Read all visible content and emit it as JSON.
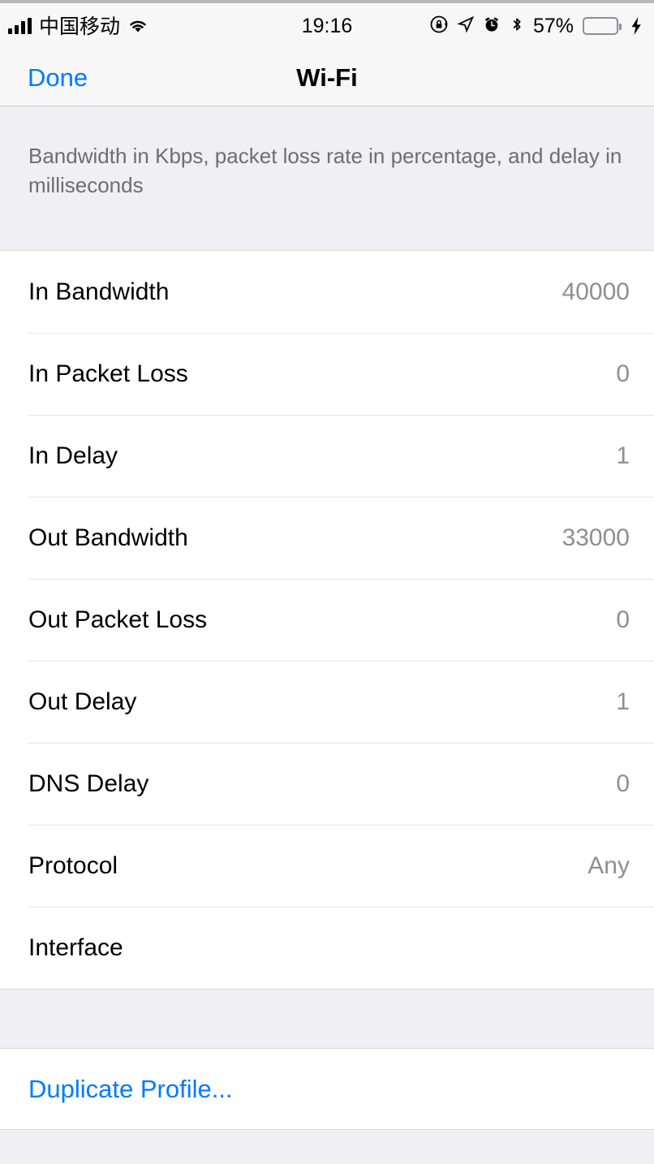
{
  "status_bar": {
    "carrier": "中国移动",
    "time": "19:16",
    "battery_percent": "57%",
    "battery_level": 57,
    "icons": {
      "signal": "signal-bars-icon",
      "wifi": "wifi-icon",
      "rotation_lock": "rotation-lock-icon",
      "location": "location-arrow-icon",
      "alarm": "alarm-clock-icon",
      "bluetooth": "bluetooth-icon",
      "battery": "battery-icon",
      "charging": "charging-bolt-icon"
    }
  },
  "nav_bar": {
    "done_label": "Done",
    "title": "Wi-Fi"
  },
  "section_header": {
    "description": "Bandwidth in Kbps, packet loss rate in percentage, and delay in milliseconds"
  },
  "settings_rows": [
    {
      "label": "In Bandwidth",
      "value": "40000"
    },
    {
      "label": "In Packet Loss",
      "value": "0"
    },
    {
      "label": "In Delay",
      "value": "1"
    },
    {
      "label": "Out Bandwidth",
      "value": "33000"
    },
    {
      "label": "Out Packet Loss",
      "value": "0"
    },
    {
      "label": "Out Delay",
      "value": "1"
    },
    {
      "label": "DNS Delay",
      "value": "0"
    },
    {
      "label": "Protocol",
      "value": "Any"
    },
    {
      "label": "Interface",
      "value": ""
    }
  ],
  "actions": [
    {
      "label": "Duplicate Profile..."
    }
  ],
  "colors": {
    "accent_blue": "#007aff",
    "value_gray": "#8e8e93",
    "group_background": "#efeff4",
    "row_background": "#ffffff",
    "battery_green": "#4cd964"
  }
}
